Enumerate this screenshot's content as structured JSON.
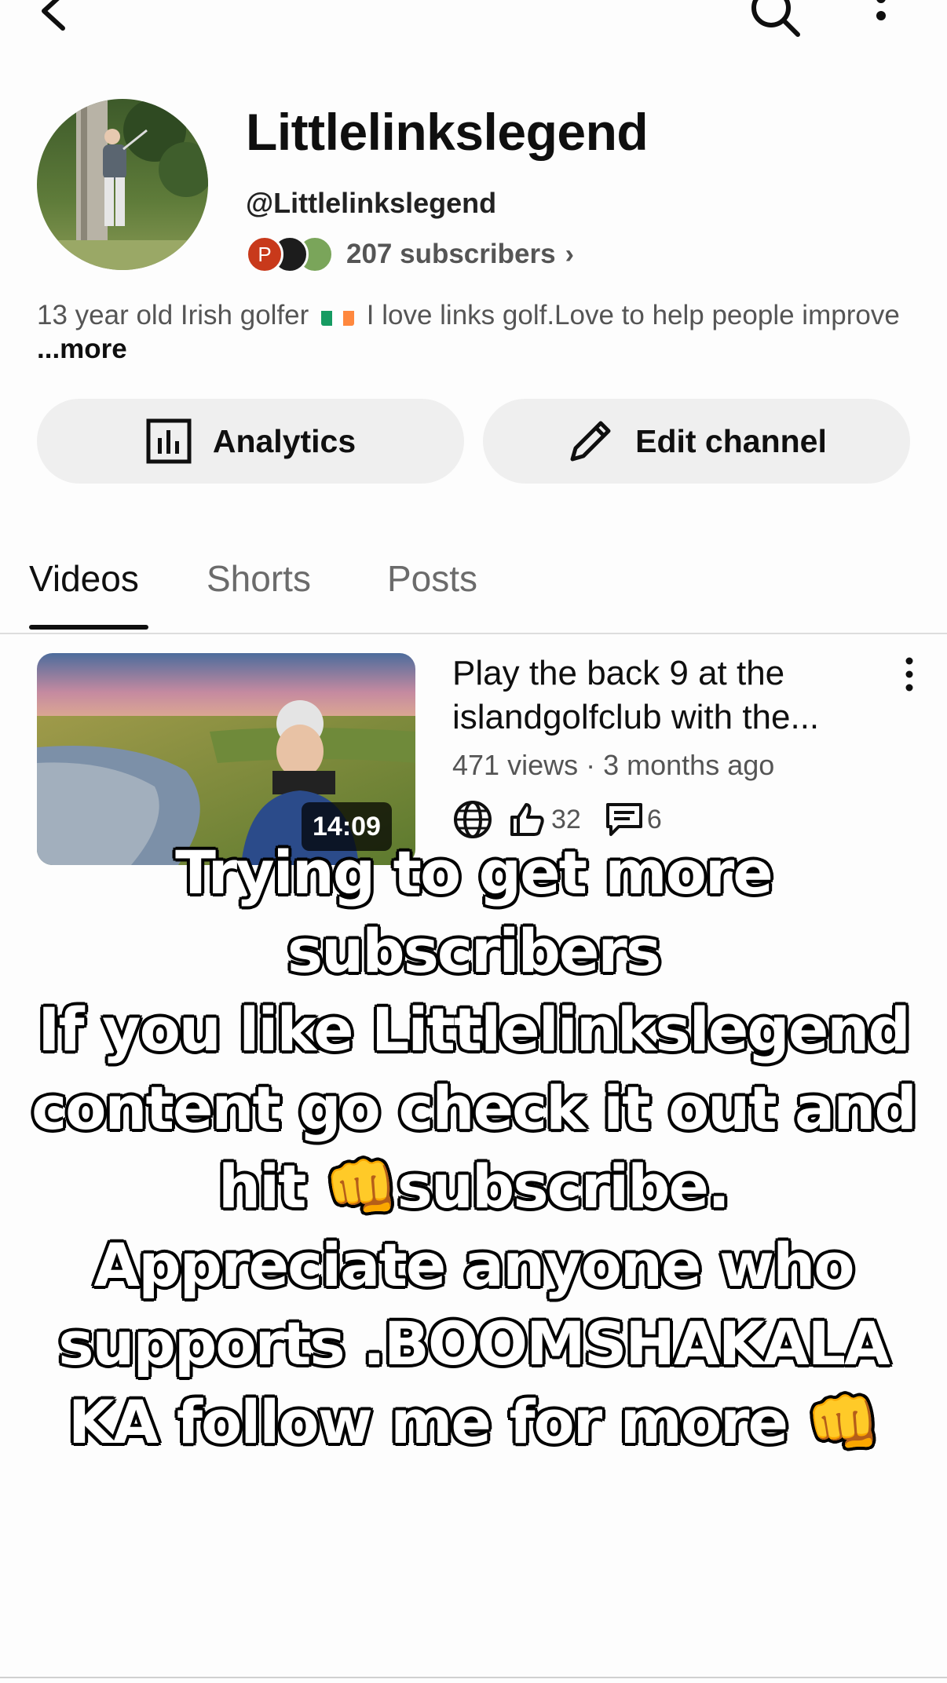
{
  "channel": {
    "name": "Littlelinkslegend",
    "handle": "@Littlelinkslegend",
    "subscriber_avatar_initial": "P",
    "subscribers_text": "207 subscribers",
    "description_part1": "13 year old Irish golfer",
    "description_part2": "I love links golf.Love to help people improve",
    "description_more": "...more"
  },
  "actions": {
    "analytics_label": "Analytics",
    "edit_label": "Edit channel"
  },
  "tabs": [
    {
      "label": "Videos",
      "active": true
    },
    {
      "label": "Shorts",
      "active": false
    },
    {
      "label": "Posts",
      "active": false
    }
  ],
  "video": {
    "title": "Play the back 9 at the islandgolfclub with the...",
    "views": "471 views",
    "age": "3 months ago",
    "meta_separator": "·",
    "duration": "14:09",
    "likes": "32",
    "comments": "6"
  },
  "overlay_text": "Trying to get more subscribers\nIf you like Littlelinkslegend content go check it out and hit 👊subscribe.\nAppreciate anyone who supports .BOOMSHAKALA KA follow me for more 👊",
  "icons": {
    "back": "chevron-left-icon",
    "search": "search-icon",
    "more": "more-vert-icon",
    "analytics": "bar-chart-icon",
    "edit": "pencil-icon",
    "visibility": "globe-icon",
    "likes": "thumbs-up-icon",
    "comments": "comment-icon"
  },
  "colors": {
    "accent_text": "#0f0f0f",
    "secondary_text": "#555555",
    "button_bg": "#efefef",
    "flag_green": "#169b62",
    "flag_orange": "#ff883e"
  }
}
